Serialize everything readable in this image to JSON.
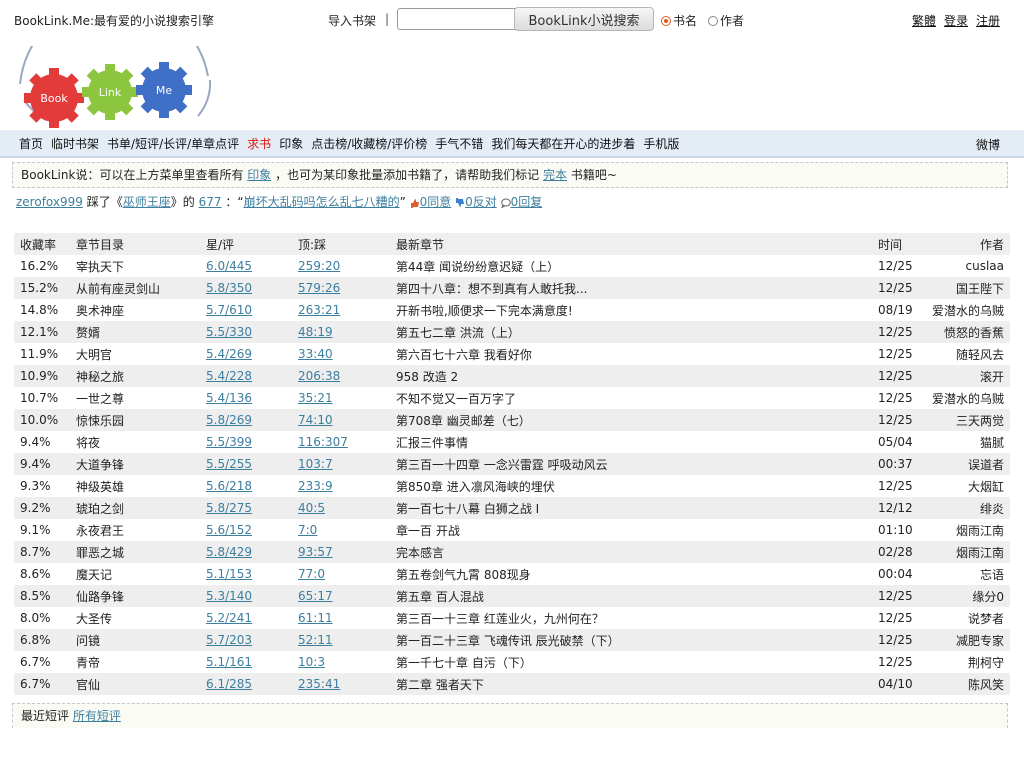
{
  "header": {
    "site_title": "BookLink.Me:最有爱的小说搜索引擎",
    "import_label": "导入书架",
    "separator": "|",
    "search": {
      "value": "",
      "placeholder": ""
    },
    "search_button": "BookLink小说搜索",
    "radio_book": "书名",
    "radio_author": "作者",
    "links": {
      "traditional": "繁體",
      "login": "登录",
      "register": "注册"
    }
  },
  "logo": {
    "book": "Book",
    "link": "Link",
    "me": "Me"
  },
  "nav": {
    "items": [
      {
        "label": "首页",
        "red": false
      },
      {
        "label": "临时书架",
        "red": false
      },
      {
        "label": "书单/短评/长评/单章点评",
        "red": false
      },
      {
        "label": "求书",
        "red": true
      },
      {
        "label": "印象",
        "red": false
      },
      {
        "label": "点击榜/收藏榜/评价榜",
        "red": false
      },
      {
        "label": "手气不错",
        "red": false
      },
      {
        "label": "我们每天都在开心的进步着",
        "red": false
      },
      {
        "label": "手机版",
        "red": false
      }
    ],
    "right": "微博"
  },
  "notice": {
    "prefix": "BookLink说：可以在上方菜单里查看所有",
    "link1": "印象",
    "middle": "，也可为某印象批量添加书籍了，请帮助我们标记",
    "link2": "完本",
    "suffix": "书籍吧~"
  },
  "activity": {
    "user": "zerofox999",
    "verb": "踩了《",
    "book": "巫师王座",
    "of": "》的",
    "num": "677",
    "colon": "：“",
    "comment": "崩坏大乱码吗怎么乱七八糟的",
    "endq": "”",
    "agree": "0同意",
    "oppose": "0反对",
    "reply": "0回复"
  },
  "table": {
    "headers": [
      "收藏率",
      "章节目录",
      "星/评",
      "顶:踩",
      "最新章节",
      "时间",
      "作者"
    ],
    "rows": [
      {
        "rate": "16.2%",
        "title": "宰执天下",
        "star": "6.0/445",
        "vote": "259:20",
        "latest": "第44章 闻说纷纷意迟疑（上）",
        "time": "12/25",
        "author": "cuslaa"
      },
      {
        "rate": "15.2%",
        "title": "从前有座灵剑山",
        "star": "5.8/350",
        "vote": "579:26",
        "latest": "第四十八章：想不到真有人敢托我...",
        "time": "12/25",
        "author": "国王陛下"
      },
      {
        "rate": "14.8%",
        "title": "奥术神座",
        "star": "5.7/610",
        "vote": "263:21",
        "latest": "开新书啦,顺便求一下完本满意度!",
        "time": "08/19",
        "author": "爱潜水的乌贼"
      },
      {
        "rate": "12.1%",
        "title": "赘婿",
        "star": "5.5/330",
        "vote": "48:19",
        "latest": "第五七二章 洪流（上）",
        "time": "12/25",
        "author": "愤怒的香蕉"
      },
      {
        "rate": "11.9%",
        "title": "大明官",
        "star": "5.4/269",
        "vote": "33:40",
        "latest": "第六百七十六章 我看好你",
        "time": "12/25",
        "author": "随轻风去"
      },
      {
        "rate": "10.9%",
        "title": "神秘之旅",
        "star": "5.4/228",
        "vote": "206:38",
        "latest": "958 改造 2",
        "time": "12/25",
        "author": "滚开"
      },
      {
        "rate": "10.7%",
        "title": "一世之尊",
        "star": "5.4/136",
        "vote": "35:21",
        "latest": "不知不觉又一百万字了",
        "time": "12/25",
        "author": "爱潜水的乌贼"
      },
      {
        "rate": "10.0%",
        "title": "惊悚乐园",
        "star": "5.8/269",
        "vote": "74:10",
        "latest": "第708章 幽灵邮差（七）",
        "time": "12/25",
        "author": "三天两觉"
      },
      {
        "rate": "9.4%",
        "title": "将夜",
        "star": "5.5/399",
        "vote": "116:307",
        "latest": "汇报三件事情",
        "time": "05/04",
        "author": "猫腻"
      },
      {
        "rate": "9.4%",
        "title": "大道争锋",
        "star": "5.5/255",
        "vote": "103:7",
        "latest": "第三百一十四章 一念兴雷霆 呼吸动风云",
        "time": "00:37",
        "author": "误道者"
      },
      {
        "rate": "9.3%",
        "title": "神级英雄",
        "star": "5.6/218",
        "vote": "233:9",
        "latest": "第850章 进入凛风海峡的埋伏",
        "time": "12/25",
        "author": "大烟缸"
      },
      {
        "rate": "9.2%",
        "title": "琥珀之剑",
        "star": "5.8/275",
        "vote": "40:5",
        "latest": "第一百七十八幕 白狮之战 I",
        "time": "12/12",
        "author": "绯炎"
      },
      {
        "rate": "9.1%",
        "title": "永夜君王",
        "star": "5.6/152",
        "vote": "7:0",
        "latest": "章一百 开战",
        "time": "01:10",
        "author": "烟雨江南"
      },
      {
        "rate": "8.7%",
        "title": "罪恶之城",
        "star": "5.8/429",
        "vote": "93:57",
        "latest": "完本感言",
        "time": "02/28",
        "author": "烟雨江南"
      },
      {
        "rate": "8.6%",
        "title": "魔天记",
        "star": "5.1/153",
        "vote": "77:0",
        "latest": "第五卷剑气九霄 808现身",
        "time": "00:04",
        "author": "忘语"
      },
      {
        "rate": "8.5%",
        "title": "仙路争锋",
        "star": "5.3/140",
        "vote": "65:17",
        "latest": "第五章 百人混战",
        "time": "12/25",
        "author": "缘分0"
      },
      {
        "rate": "8.0%",
        "title": "大圣传",
        "star": "5.2/241",
        "vote": "61:11",
        "latest": "第三百一十三章 红莲业火，九州何在？",
        "time": "12/25",
        "author": "说梦者"
      },
      {
        "rate": "6.8%",
        "title": "问镜",
        "star": "5.7/203",
        "vote": "52:11",
        "latest": "第一百二十三章 飞魂传讯 辰光破禁（下）",
        "time": "12/25",
        "author": "减肥专家"
      },
      {
        "rate": "6.7%",
        "title": "青帝",
        "star": "5.1/161",
        "vote": "10:3",
        "latest": "第一千七十章 自污（下）",
        "time": "12/25",
        "author": "荆柯守"
      },
      {
        "rate": "6.7%",
        "title": "官仙",
        "star": "6.1/285",
        "vote": "235:41",
        "latest": "第二章 强者天下",
        "time": "04/10",
        "author": "陈风笑"
      }
    ]
  },
  "recent": {
    "label": "最近短评",
    "link": "所有短评"
  }
}
